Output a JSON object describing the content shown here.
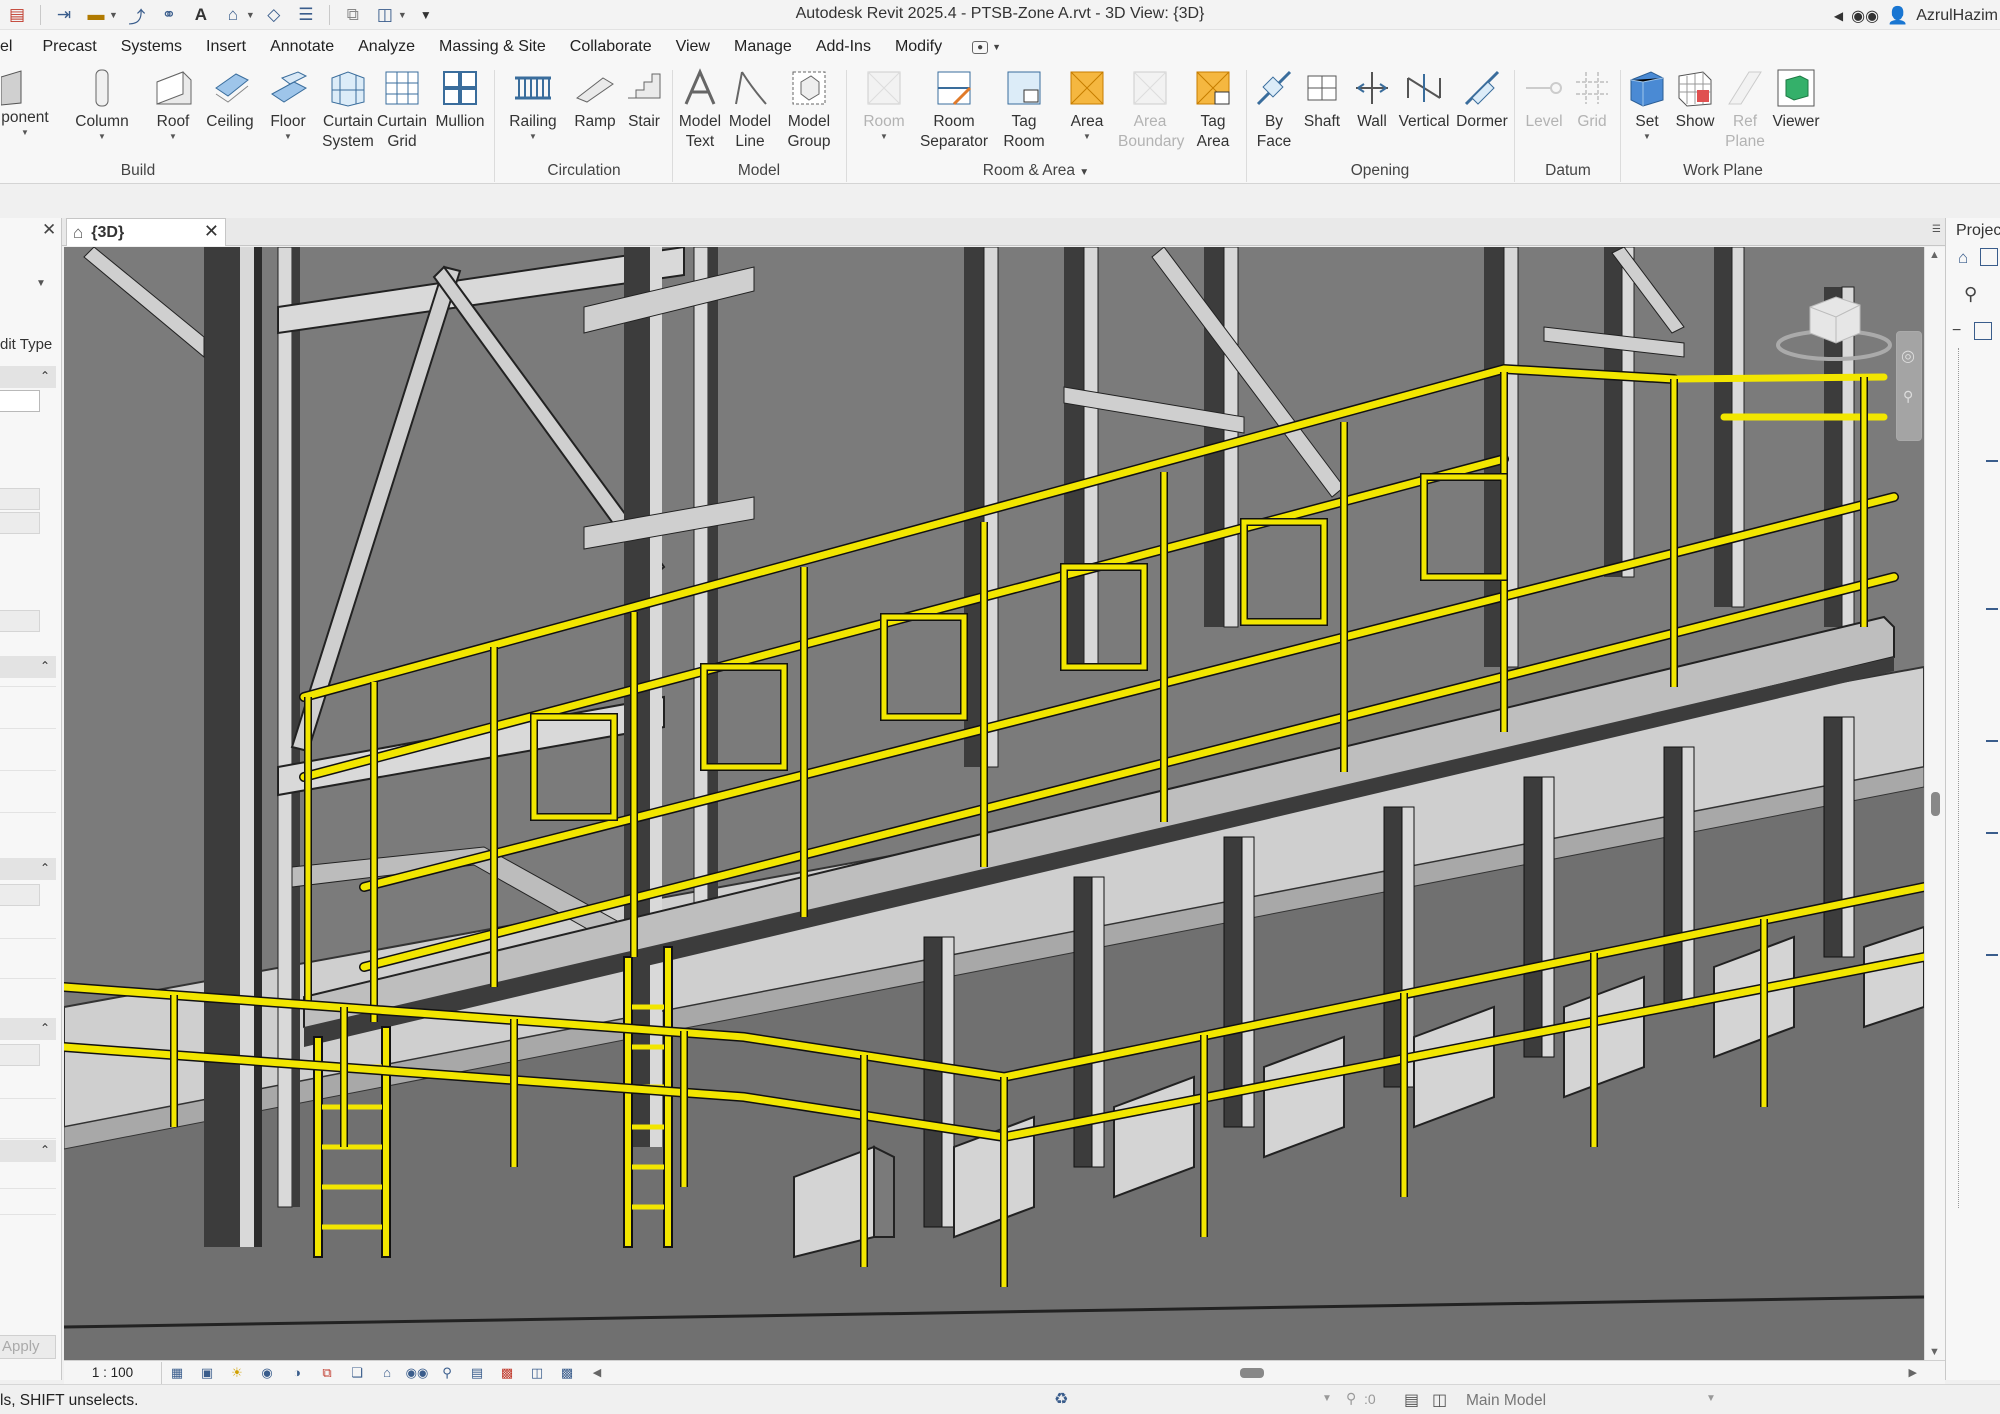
{
  "window": {
    "title": "Autodesk Revit 2025.4 - PTSB-Zone A.rvt - 3D View: {3D}",
    "user": "AzrulHazim"
  },
  "menu": {
    "items": [
      "el",
      "Precast",
      "Systems",
      "Insert",
      "Annotate",
      "Analyze",
      "Massing & Site",
      "Collaborate",
      "View",
      "Manage",
      "Add-Ins",
      "Modify"
    ]
  },
  "ribbon": {
    "build": {
      "label": "Build",
      "component": "ponent",
      "column": "Column",
      "roof": "Roof",
      "ceiling": "Ceiling",
      "floor": "Floor",
      "curtain_system": [
        "Curtain",
        "System"
      ],
      "curtain_grid": [
        "Curtain",
        "Grid"
      ],
      "mullion": "Mullion"
    },
    "circulation": {
      "label": "Circulation",
      "railing": "Railing",
      "ramp": "Ramp",
      "stair": "Stair"
    },
    "model": {
      "label": "Model",
      "model_text": [
        "Model",
        "Text"
      ],
      "model_line": [
        "Model",
        "Line"
      ],
      "model_group": [
        "Model",
        "Group"
      ]
    },
    "room_area": {
      "label": "Room & Area",
      "room": "Room",
      "room_separator": [
        "Room",
        "Separator"
      ],
      "tag_room": [
        "Tag",
        "Room"
      ],
      "area": "Area",
      "area_boundary": [
        "Area",
        "Boundary"
      ],
      "tag_area": [
        "Tag",
        "Area"
      ]
    },
    "opening": {
      "label": "Opening",
      "by_face": [
        "By",
        "Face"
      ],
      "shaft": "Shaft",
      "wall": "Wall",
      "vertical": "Vertical",
      "dormer": "Dormer"
    },
    "datum": {
      "label": "Datum",
      "level": "Level",
      "grid": "Grid"
    },
    "work_plane": {
      "label": "Work Plane",
      "set": "Set",
      "show": "Show",
      "ref_plane": [
        "Ref",
        "Plane"
      ],
      "viewer": "Viewer"
    }
  },
  "properties": {
    "edit_type": "dit Type",
    "apply": "Apply"
  },
  "view": {
    "tab_label": "{3D}",
    "scale": "1 : 100"
  },
  "project_browser": {
    "title": "Project"
  },
  "status": {
    "hint": "ls, SHIFT unselects.",
    "selection_count": ":0",
    "model": "Main Model"
  },
  "colors": {
    "railing": "#f2e600",
    "steel_dark": "#3c3c3c",
    "steel_light": "#d9d9d9",
    "concrete": "#c8c8c8",
    "background": "#7b7b7b",
    "accent": "#3a5d8c"
  }
}
